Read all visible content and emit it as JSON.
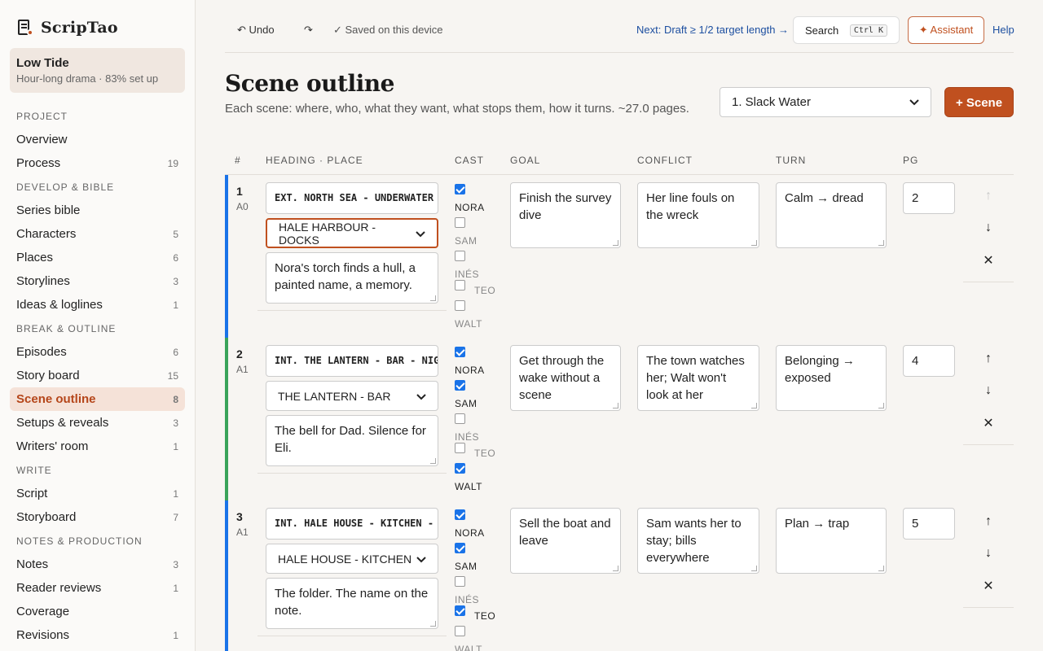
{
  "app": {
    "name": "ScripTao"
  },
  "project": {
    "title": "Low Tide",
    "subtitle": "Hour-long drama · 83% set up"
  },
  "sidebar": {
    "sections": [
      {
        "label": "PROJECT",
        "items": [
          {
            "label": "Overview",
            "count": ""
          },
          {
            "label": "Process",
            "count": "19"
          }
        ]
      },
      {
        "label": "DEVELOP & BIBLE",
        "items": [
          {
            "label": "Series bible",
            "count": ""
          },
          {
            "label": "Characters",
            "count": "5"
          },
          {
            "label": "Places",
            "count": "6"
          },
          {
            "label": "Storylines",
            "count": "3"
          },
          {
            "label": "Ideas & loglines",
            "count": "1"
          }
        ]
      },
      {
        "label": "BREAK & OUTLINE",
        "items": [
          {
            "label": "Episodes",
            "count": "6"
          },
          {
            "label": "Story board",
            "count": "15"
          },
          {
            "label": "Scene outline",
            "count": "8",
            "active": true
          },
          {
            "label": "Setups & reveals",
            "count": "3"
          },
          {
            "label": "Writers' room",
            "count": "1"
          }
        ]
      },
      {
        "label": "WRITE",
        "items": [
          {
            "label": "Script",
            "count": "1"
          },
          {
            "label": "Storyboard",
            "count": "7"
          }
        ]
      },
      {
        "label": "NOTES & PRODUCTION",
        "items": [
          {
            "label": "Notes",
            "count": "3"
          },
          {
            "label": "Reader reviews",
            "count": "1"
          },
          {
            "label": "Coverage",
            "count": ""
          },
          {
            "label": "Revisions",
            "count": "1"
          }
        ]
      }
    ]
  },
  "toolbar": {
    "undo": "↶ Undo",
    "redo": "↷",
    "saved": "✓ Saved on this device",
    "next": "Next: Draft ≥ 1/2 target length →",
    "search": "Search",
    "search_kbd": "Ctrl K",
    "assistant": "✦ Assistant",
    "help": "Help"
  },
  "page": {
    "title": "Scene outline",
    "subtitle": "Each scene: where, who, what they want, what stops them, how it turns. ~27.0 pages.",
    "episode_select": "1. Slack Water",
    "add_scene": "+ Scene"
  },
  "table": {
    "headers": {
      "num": "#",
      "heading": "HEADING · PLACE",
      "cast": "CAST",
      "goal": "GOAL",
      "conflict": "CONFLICT",
      "turn": "TURN",
      "pg": "PG"
    },
    "cast_names": [
      "NORA",
      "SAM",
      "INÉS",
      "TEO",
      "WALT"
    ],
    "rows": [
      {
        "num": "1",
        "act": "A0",
        "accent": "#1a73e8",
        "heading": "EXT. NORTH SEA - UNDERWATER - NIGHT",
        "place": "HALE HARBOUR - DOCKS",
        "summary": "Nora's torch finds a hull, a painted name, a memory.",
        "cast": [
          true,
          false,
          false,
          false,
          false
        ],
        "goal": "Finish the survey dive",
        "conflict": "Her line fouls on the wreck",
        "turn": "Calm → dread",
        "pg": "2"
      },
      {
        "num": "2",
        "act": "A1",
        "accent": "#3aa35a",
        "heading": "INT. THE LANTERN - BAR - NIGHT",
        "place": "THE LANTERN - BAR",
        "summary": "The bell for Dad. Silence for Eli.",
        "cast": [
          true,
          true,
          false,
          false,
          true
        ],
        "goal": "Get through the wake without a scene",
        "conflict": "The town watches her; Walt won't look at her",
        "turn": "Belonging → exposed",
        "pg": "4"
      },
      {
        "num": "3",
        "act": "A1",
        "accent": "#1a73e8",
        "heading": "INT. HALE HOUSE - KITCHEN - DAY",
        "place": "HALE HOUSE - KITCHEN",
        "summary": "The folder. The name on the note.",
        "cast": [
          true,
          true,
          false,
          true,
          false
        ],
        "goal": "Sell the boat and leave",
        "conflict": "Sam wants her to stay; bills everywhere",
        "turn": "Plan → trap",
        "pg": "5"
      }
    ],
    "row_actions": {
      "up": "↑",
      "down": "↓",
      "delete": "✕"
    }
  }
}
